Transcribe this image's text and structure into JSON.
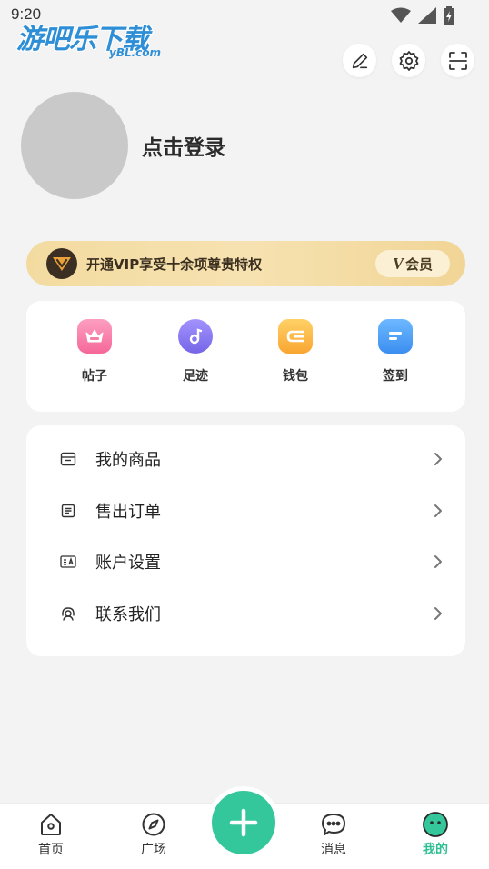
{
  "status_bar": {
    "time": "9:20"
  },
  "watermark": {
    "text": "游吧乐下载",
    "sub": "yBL.com"
  },
  "top_actions": {
    "icons": [
      "edit-icon",
      "gear-icon",
      "scan-icon"
    ]
  },
  "profile": {
    "login_text": "点击登录"
  },
  "vip": {
    "text": "开通VIP享受十余项尊贵特权",
    "badge_v": "V",
    "badge_label": "会员",
    "colors": {
      "banner": "#f3dba0",
      "logo": "#3a2f22"
    }
  },
  "shortcuts": [
    {
      "label": "帖子",
      "icon": "crown-icon",
      "color": "#f77fa7"
    },
    {
      "label": "足迹",
      "icon": "music-note-icon",
      "color": "#8f7cf2"
    },
    {
      "label": "钱包",
      "icon": "wallet-icon",
      "color": "#fbb34a"
    },
    {
      "label": "签到",
      "icon": "checkin-icon",
      "color": "#4f9ff5"
    }
  ],
  "menu": [
    {
      "label": "我的商品",
      "icon": "store-icon"
    },
    {
      "label": "售出订单",
      "icon": "order-icon"
    },
    {
      "label": "账户设置",
      "icon": "account-card-icon"
    },
    {
      "label": "联系我们",
      "icon": "support-icon"
    }
  ],
  "bottom_nav": {
    "items": [
      {
        "label": "首页",
        "icon": "home-icon",
        "active": false
      },
      {
        "label": "广场",
        "icon": "compass-icon",
        "active": false
      },
      {
        "label": "消息",
        "icon": "message-icon",
        "active": false
      },
      {
        "label": "我的",
        "icon": "profile-face-icon",
        "active": true
      }
    ],
    "fab_icon": "plus-icon",
    "accent_color": "#34c79c"
  }
}
